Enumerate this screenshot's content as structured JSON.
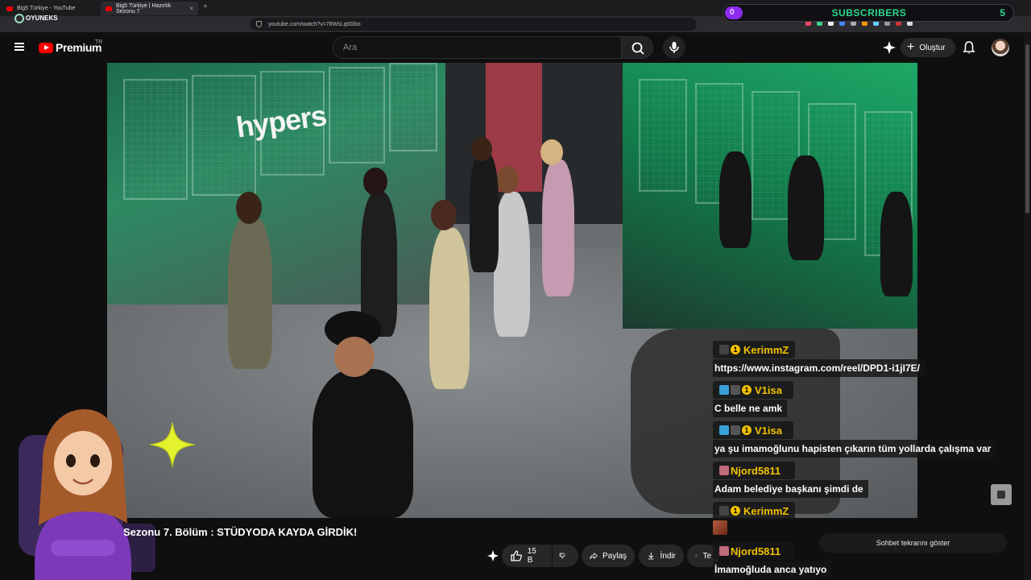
{
  "browser": {
    "tabs": [
      {
        "label": "Big5 Türkiye - YouTube"
      },
      {
        "label": "Big5 Türkiye | Hazırlık Sezonu 7"
      }
    ],
    "url": "youtube.com/watch?v=78WsLqtIGbo"
  },
  "overlay": {
    "subscriber_title": "SUBSCRIBERS",
    "subscriber_count": "0",
    "subscriber_goal": "5",
    "logo_text": "OYUNEKS",
    "accent_color": "#2cd88d",
    "bar_color": "#8e2bf0"
  },
  "youtube": {
    "brand": "Premium",
    "country": "TR",
    "search_placeholder": "Ara",
    "create_label": "Oluştur",
    "video_title": "Sezonu 7. Bölüm : STÜDYODA KAYDA GİRDİK!",
    "video_wall_text": "hypers",
    "actions": {
      "likes": "15 B",
      "share": "Paylaş",
      "download": "İndir",
      "thanks": "Te"
    },
    "chat_replay_label": "Sohbet tekrarını göster"
  },
  "chat": [
    {
      "user": "KerimmZ",
      "coin": "1",
      "text": "https://www.instagram.com/reel/DPD1-i1jI7E/"
    },
    {
      "user": "V1isa",
      "coin": "1",
      "text": "C belle ne amk"
    },
    {
      "user": "V1isa",
      "coin": "1",
      "text": "ya şu imamoğlunu hapisten çıkarın tüm yollarda çalışma var"
    },
    {
      "user": "Njord5811",
      "coin": "",
      "text": "Adam belediye başkanı şimdi de"
    },
    {
      "user": "KerimmZ",
      "coin": "1",
      "text": ""
    },
    {
      "user": "Njord5811",
      "coin": "",
      "text": "İmamoğluda anca yatıyo"
    }
  ]
}
